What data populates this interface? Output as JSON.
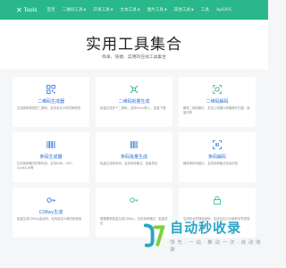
{
  "nav": {
    "brand": "Tools",
    "items": [
      {
        "label": "首页"
      },
      {
        "label": "二维码工具",
        "dropdown": true
      },
      {
        "label": "开发工具",
        "dropdown": true
      },
      {
        "label": "文本工具",
        "dropdown": true
      },
      {
        "label": "图片工具",
        "dropdown": true
      },
      {
        "label": "其他工具",
        "dropdown": true
      },
      {
        "label": "工具"
      },
      {
        "label": "ApiDOC"
      }
    ]
  },
  "hero": {
    "title": "实用工具集合",
    "subtitle": "简单、快捷、实用的在线工具集合"
  },
  "cards": [
    {
      "title": "二维码生成器",
      "desc": "生成各种类型的二维码，支持自定义样式和颜色"
    },
    {
      "title": "二维码批量生成",
      "desc": "批量生成多个二维码，支持Excel导入，批量下载"
    },
    {
      "title": "二维码解码",
      "desc": "解析二维码图片，支持上传图片和摄像头扫描，批量识别"
    },
    {
      "title": "条码生成器",
      "desc": "生成各种格式的条形码，支持EAN、UPC、Code128等"
    },
    {
      "title": "条码批量生成",
      "desc": "批量生成条形码，支持多种格式，批量导出"
    },
    {
      "title": "条码解码",
      "desc": "解析条形码图片，支持多种格式自动识别"
    },
    {
      "title": "CDKey生成",
      "desc": "批量生成CDKey激活码，支持自定义格式和规则"
    },
    {
      "title": "",
      "desc": "根据需求批量生成CDKey，支持多种格式，批量导出"
    },
    {
      "title": "",
      "desc": "生成安全的随机密码，支持自定义长度和字符类型"
    }
  ],
  "watermark": {
    "main": "自动秒收录",
    "sub": "领 先 · 一 站 · 推 动 一 次 · 自 动 收 录"
  },
  "colors": {
    "nav": "#2ab88a",
    "card_title": "#2a6fdb",
    "accent_green": "#2ab88a",
    "watermark": "#2aa5c8"
  }
}
